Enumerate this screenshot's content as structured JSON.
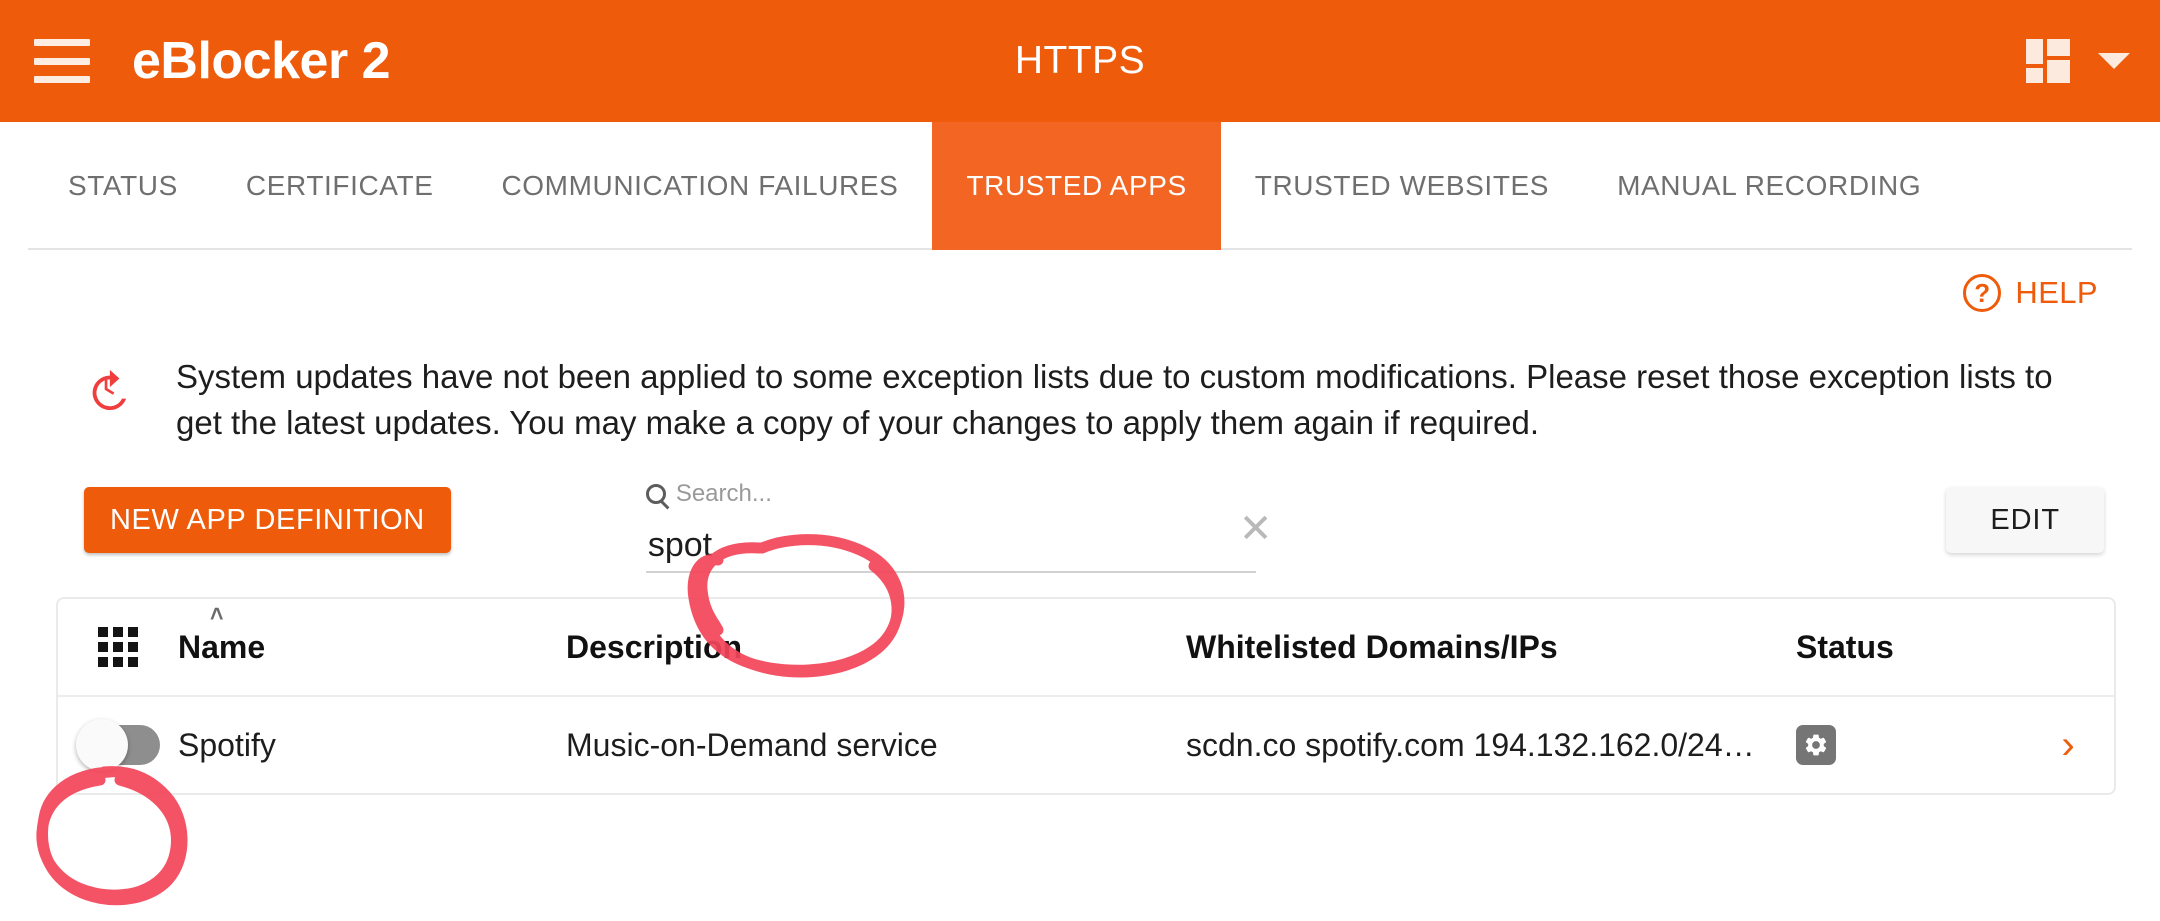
{
  "appbar": {
    "menu_icon": "hamburger-menu-icon",
    "brand": "eBlocker 2",
    "title": "HTTPS",
    "dashboard_icon": "dashboard-grid-icon",
    "caret_icon": "chevron-down-icon"
  },
  "tabs": [
    {
      "label": "STATUS",
      "active": false
    },
    {
      "label": "CERTIFICATE",
      "active": false
    },
    {
      "label": "COMMUNICATION FAILURES",
      "active": false
    },
    {
      "label": "TRUSTED APPS",
      "active": true
    },
    {
      "label": "TRUSTED WEBSITES",
      "active": false
    },
    {
      "label": "MANUAL RECORDING",
      "active": false
    }
  ],
  "help": {
    "label": "HELP",
    "icon": "question-mark-circle-icon",
    "glyph": "?"
  },
  "notice": {
    "icon": "update-history-icon",
    "text": "System updates have not been applied to some exception lists due to custom modifications. Please reset those exception lists to get the latest updates. You may make a copy of your changes to apply them again if required."
  },
  "actions": {
    "new_app_label": "NEW APP DEFINITION",
    "edit_label": "EDIT",
    "search": {
      "label": "Search...",
      "placeholder": "Search...",
      "value": "spot",
      "search_icon": "search-icon",
      "clear_icon": "close-icon",
      "clear_glyph": "✕"
    }
  },
  "table": {
    "grid_icon": "grid-columns-icon",
    "sort_caret": "˄",
    "columns": [
      {
        "key": "name",
        "label": "Name"
      },
      {
        "key": "description",
        "label": "Description"
      },
      {
        "key": "domains",
        "label": "Whitelisted Domains/IPs"
      },
      {
        "key": "status",
        "label": "Status"
      }
    ],
    "rows": [
      {
        "enabled": false,
        "name": "Spotify",
        "description": "Music-on-Demand service",
        "domains": "scdn.co spotify.com 194.132.162.0/24…",
        "status_icon": "gear-icon",
        "chevron": "›"
      }
    ]
  },
  "colors": {
    "brand_orange": "#ED5B0B",
    "tab_active": "#F26522",
    "notice_red": "#F03E3E",
    "annotation_red": "#F4455A",
    "toggle_off": "#8E8E8E",
    "status_badge": "#757575"
  }
}
